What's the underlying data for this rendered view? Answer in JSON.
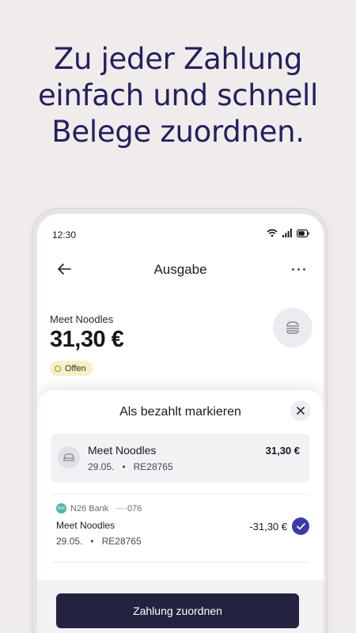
{
  "headline": {
    "line1": "Zu jeder Zahlung",
    "line2": "einfach und schnell",
    "line3": "Belege zuordnen."
  },
  "statusbar": {
    "time": "12:30",
    "icons": [
      "wifi-icon",
      "signal-icon",
      "battery-icon"
    ]
  },
  "topbar": {
    "back_icon": "arrow-left-icon",
    "title": "Ausgabe",
    "menu_icon": "more-horizontal-icon"
  },
  "transaction": {
    "merchant": "Meet Noodles",
    "amount": "31,30 €",
    "status": "Offen",
    "category_icon": "burger-icon"
  },
  "sheet": {
    "title": "Als bezahlt markieren",
    "close_icon": "close-icon",
    "document": {
      "name": "Meet Noodles",
      "date": "29.05.",
      "separator": "•",
      "reference": "RE28765",
      "amount": "31,30 €",
      "icon": "car-icon"
    },
    "bank_payment": {
      "bank_logo_text": "N26",
      "bank_name": "N26 Bank",
      "account": "····076",
      "merchant": "Meet Noodles",
      "date": "29.05.",
      "separator": "•",
      "reference": "RE28765",
      "amount": "-31,30 €",
      "selected": true
    },
    "assign_button": "Zahlung zuordnen"
  },
  "colors": {
    "background": "#f1ecec",
    "headline": "#23215e",
    "button": "#23223f",
    "check": "#3a3aa8",
    "badge": "#f8efc8"
  }
}
